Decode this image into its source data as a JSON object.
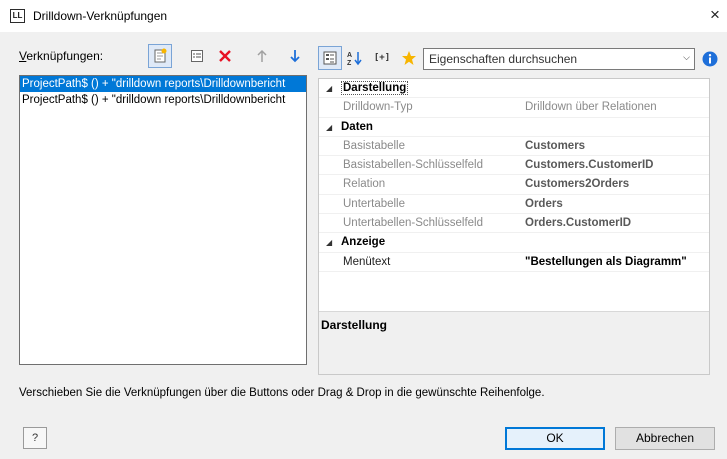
{
  "window": {
    "app_icon_text": "LL",
    "title": "Drilldown-Verknüpfungen",
    "close_glyph": "×"
  },
  "links": {
    "label_access_key": "V",
    "label_rest": "erknüpfungen:",
    "toolbar": [
      {
        "name": "new-link-icon"
      },
      {
        "name": "properties-list-icon"
      },
      {
        "name": "delete-icon",
        "color": "#e81123"
      },
      {
        "name": "move-up-icon"
      },
      {
        "name": "move-down-icon",
        "color": "#1e6fd9"
      }
    ],
    "items": [
      {
        "text": "ProjectPath$ () + \"drilldown reports\\Drilldownbericht",
        "selected": true
      },
      {
        "text": "ProjectPath$ () + \"drilldown reports\\Drilldownbericht",
        "selected": false
      }
    ]
  },
  "properties": {
    "toolbar": {
      "categorized_icon": "categorized-icon",
      "sort_icon": "sort-az-icon",
      "expand_label": "[+]",
      "favorites_icon": "star-icon",
      "favorite_color": "#f7b500",
      "info_icon": "info-icon",
      "info_color": "#1e6fd9"
    },
    "search": {
      "placeholder": "Eigenschaften durchsuchen"
    },
    "categories": [
      {
        "title": "Darstellung",
        "rows": [
          {
            "key": "Drilldown-Typ",
            "value": "Drilldown über Relationen",
            "style": "normal"
          }
        ]
      },
      {
        "title": "Daten",
        "rows": [
          {
            "key": "Basistabelle",
            "value": "Customers",
            "style": "bold"
          },
          {
            "key": "Basistabellen-Schlüsselfeld",
            "value": "Customers.CustomerID",
            "style": "bold"
          },
          {
            "key": "Relation",
            "value": "Customers2Orders",
            "style": "bold"
          },
          {
            "key": "Untertabelle",
            "value": "Orders",
            "style": "bold"
          },
          {
            "key": "Untertabellen-Schlüsselfeld",
            "value": "Orders.CustomerID",
            "style": "bold"
          }
        ]
      },
      {
        "title": "Anzeige",
        "rows": [
          {
            "key": "Menütext",
            "value": "\"Bestellungen als Diagramm\"",
            "style": "black"
          }
        ]
      }
    ],
    "description_title": "Darstellung"
  },
  "hint": "Verschieben Sie die Verknüpfungen über die Buttons oder Drag & Drop in die gewünschte Reihenfolge.",
  "buttons": {
    "help": "?",
    "ok": "OK",
    "cancel": "Abbrechen"
  }
}
